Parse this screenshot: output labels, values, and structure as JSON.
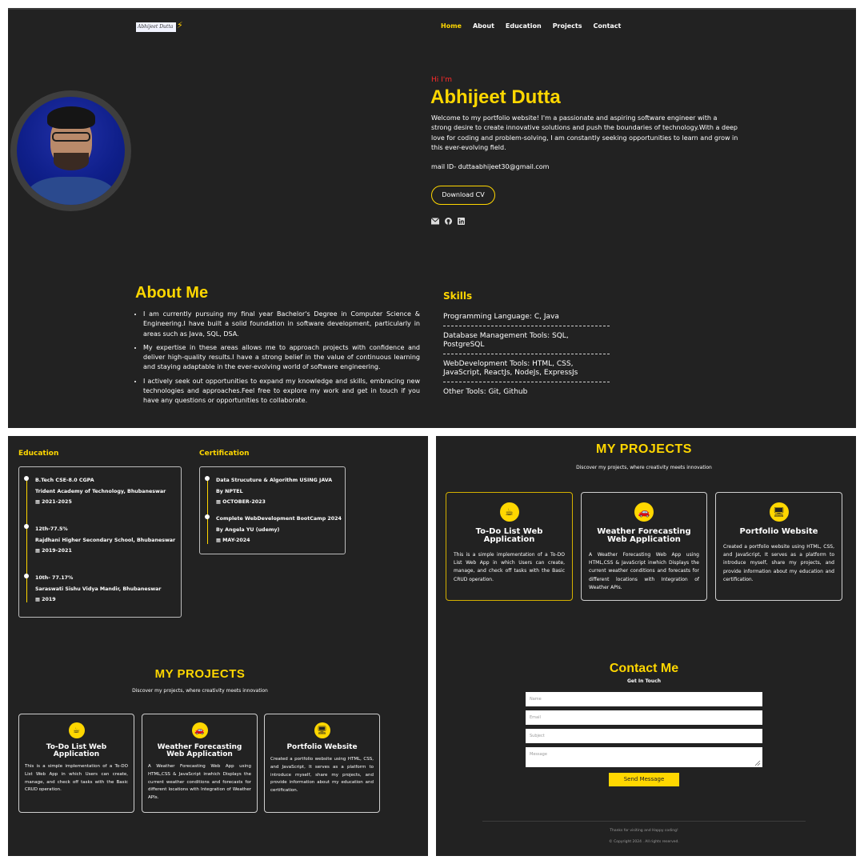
{
  "header": {
    "logo_text": "Abhijeet Dutta",
    "nav": [
      "Home",
      "About",
      "Education",
      "Projects",
      "Contact"
    ]
  },
  "hero": {
    "greeting": "Hi I'm",
    "name": "Abhijeet Dutta",
    "intro": "Welcome to my portfolio website! I'm a passionate and aspiring software engineer with a strong desire to create innovative solutions and push the boundaries of technology.With a deep love for coding and problem-solving, I am constantly seeking opportunities to learn and grow in this ever-evolving field.",
    "mail": "mail ID- duttaabhijeet30@gmail.com",
    "cv_button": "Download CV",
    "socials": [
      "envelope-icon",
      "github-icon",
      "linkedin-icon"
    ]
  },
  "about": {
    "title": "About Me",
    "points": [
      "I am currently pursuing my final year Bachelor's Degree in Computer Science & Engineering.I have built a solid foundation in software development, particularly in areas such as Java, SQL, DSA.",
      "My expertise in these areas allows me to approach projects with confidence and deliver high-quality results.I have a strong belief in the value of continuous learning and staying adaptable in the ever-evolving world of software engineering.",
      "I actively seek out opportunities to expand my knowledge and skills, embracing new technologies and approaches.Feel free to explore my work and get in touch if you have any questions or opportunities to collaborate."
    ]
  },
  "skills": {
    "title": "Skills",
    "items": [
      "Programming Language: C, Java",
      "Database Management Tools: SQL, PostgreSQL",
      "WebDevelopment Tools: HTML, CSS, JavaScript, ReactJs, NodeJs, ExpressJs",
      "Other Tools: Git, Github"
    ]
  },
  "education": {
    "title": "Education",
    "items": [
      {
        "degree": "B.Tech CSE-8.0 CGPA",
        "school": "Trident Academy of Technology, Bhubaneswar",
        "years": "2021-2025"
      },
      {
        "degree": "12th-77.5%",
        "school": "Rajdhani Higher Secondary School, Bhubaneswar",
        "years": "2019-2021"
      },
      {
        "degree": "10th- 77.17%",
        "school": "Saraswati Sishu Vidya Mandir, Bhubaneswar",
        "years": "2019"
      }
    ]
  },
  "certification": {
    "title": "Certification",
    "items": [
      {
        "name": "Data Strucuture & Algorithm USING JAVA",
        "by": "By NPTEL",
        "date": "OCTOBER-2023"
      },
      {
        "name": "Complete WebDevelopment BootCamp 2024",
        "by": "By Angela YU (udemy)",
        "date": "MAY-2024"
      }
    ]
  },
  "projects": {
    "title": "MY PROJECTS",
    "subtitle": "Discover my projects, where creativity meets innovation",
    "cards": [
      {
        "icon": "coffee-icon",
        "title": "To-Do List Web Application",
        "desc": "This is a simple implementation of a To-DO List Web App in which Users can create, manage, and check off tasks with the Basic CRUD operation."
      },
      {
        "icon": "car-icon",
        "title": "Weather Forecasting Web Application",
        "desc": "A Weather Forecasting Web App using HTML,CSS & JavaScript inwhich Displays the current weather conditions and forecasts for different locations with Integration of Weather APIs."
      },
      {
        "icon": "monitor-icon",
        "title": "Portfolio Website",
        "desc": "Created a portfolio website using HTML, CSS, and JavaScript, It serves as a platform to introduce myself, share my projects, and provide information about my education and certification."
      }
    ]
  },
  "contact": {
    "title": "Contact Me",
    "subtitle": "Get In Touch",
    "placeholders": {
      "name": "Name",
      "email": "Email",
      "subject": "Subject",
      "message": "Message"
    },
    "send_button": "Send Message"
  },
  "footer": {
    "thanks": "Thanks for visiting and Happy coding!",
    "copyright": "© Copyright 2024 . All rights reserved."
  }
}
